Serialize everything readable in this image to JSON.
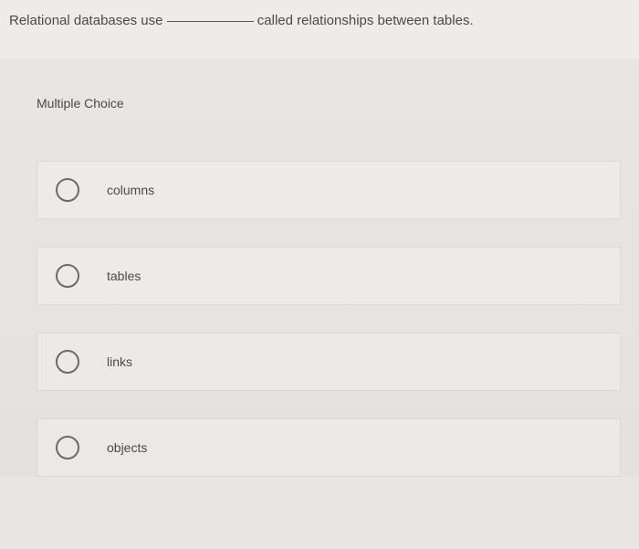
{
  "question": {
    "prefix": "Relational databases use ",
    "suffix": " called relationships between tables."
  },
  "section_label": "Multiple Choice",
  "options": [
    {
      "label": "columns"
    },
    {
      "label": "tables"
    },
    {
      "label": "links"
    },
    {
      "label": "objects"
    }
  ]
}
